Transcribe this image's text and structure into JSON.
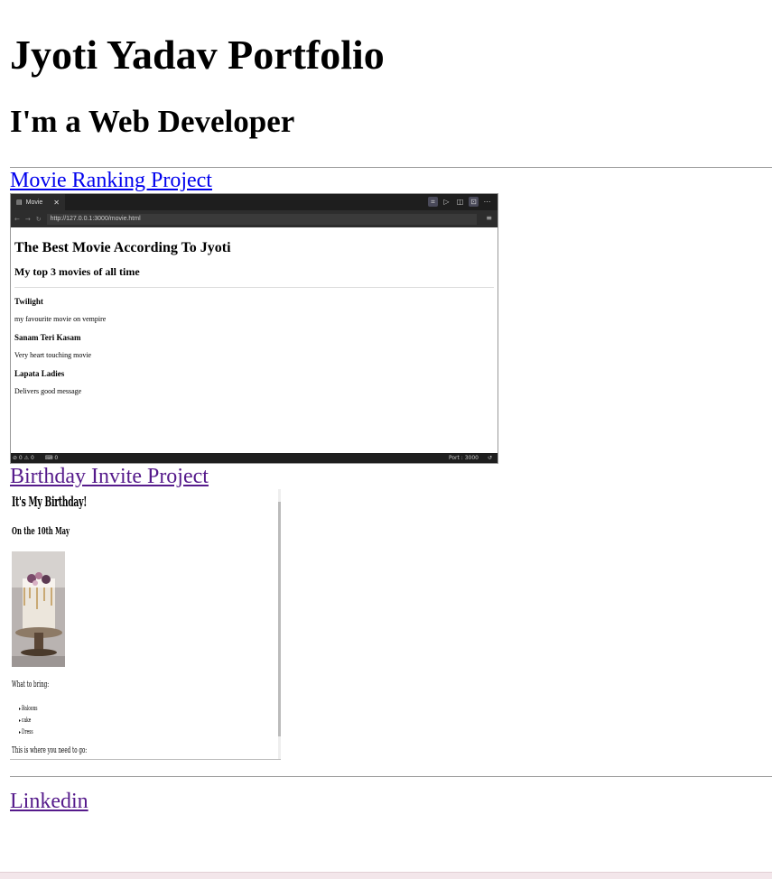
{
  "page": {
    "title": "Jyoti Yadav Portfolio",
    "subtitle": "I'm a Web Developer"
  },
  "projects": [
    {
      "link_label": "Movie Ranking Project",
      "screenshot": {
        "tab_label": "Movie",
        "url": "http://127.0.0.1:3000/movie.html",
        "heading": "The Best Movie According To Jyoti",
        "subheading": "My top 3 movies of all time",
        "movies": [
          {
            "title": "Twilight",
            "description": "my favourite movie on vempire"
          },
          {
            "title": "Sanam Teri Kasam",
            "description": "Very heart touching movie"
          },
          {
            "title": "Lapata Ladies",
            "description": "Delivers good message"
          }
        ],
        "status_left": "⊘ 0 ⚠ 0",
        "status_mid": "⌨ 0",
        "status_port": "Port : 3000"
      }
    },
    {
      "link_label": "Birthday Invite Project",
      "screenshot": {
        "heading": "It's My Birthday!",
        "date": "On the 10th May",
        "bring_label": "What to bring:",
        "items": [
          "Baloons",
          "cake",
          "Dress"
        ],
        "where_label": "This is where you need to go:"
      }
    }
  ],
  "footer": {
    "linkedin_label": "Linkedin"
  },
  "colors": {
    "link": "#0000ee",
    "visited_link": "#551a8b"
  }
}
